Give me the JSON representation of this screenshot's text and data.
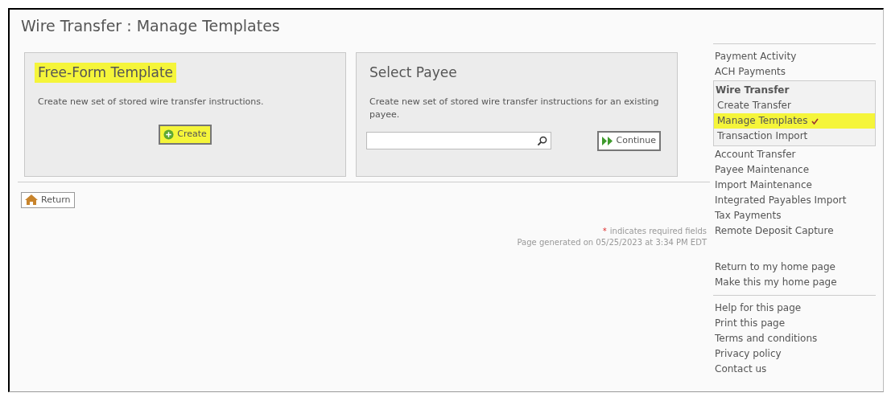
{
  "page_title": "Wire Transfer : Manage Templates",
  "cards": [
    {
      "kind": "create",
      "title": "Free-Form Template",
      "title_highlighted": true,
      "description": "Create new set of stored wire transfer instructions.",
      "button": {
        "label": "Create",
        "highlighted": true
      }
    },
    {
      "kind": "search",
      "title": "Select Payee",
      "description": "Create new set of stored wire transfer instructions for an existing payee.",
      "button": {
        "label": "Continue",
        "highlighted": false
      }
    }
  ],
  "return_button": "Return",
  "required_note": {
    "marker": "*",
    "text": "indicates required fields"
  },
  "generated": "Page generated on 05/25/2023 at 3:34 PM EDT",
  "sidebar": {
    "nav": [
      {
        "label": "Payment Activity"
      },
      {
        "label": "ACH Payments"
      },
      {
        "label": "Wire Transfer",
        "expanded": true,
        "children": [
          {
            "label": "Create Transfer",
            "selected": false
          },
          {
            "label": "Manage Templates",
            "selected": true
          },
          {
            "label": "Transaction Import",
            "selected": false
          }
        ]
      },
      {
        "label": "Account Transfer"
      },
      {
        "label": "Payee Maintenance"
      },
      {
        "label": "Import Maintenance"
      },
      {
        "label": "Integrated Payables Import"
      },
      {
        "label": "Tax Payments"
      },
      {
        "label": "Remote Deposit Capture"
      }
    ],
    "home_links": [
      "Return to my home page",
      "Make this my home page"
    ],
    "help_links": [
      "Help for this page",
      "Print this page",
      "Terms and conditions",
      "Privacy policy",
      "Contact us"
    ]
  }
}
